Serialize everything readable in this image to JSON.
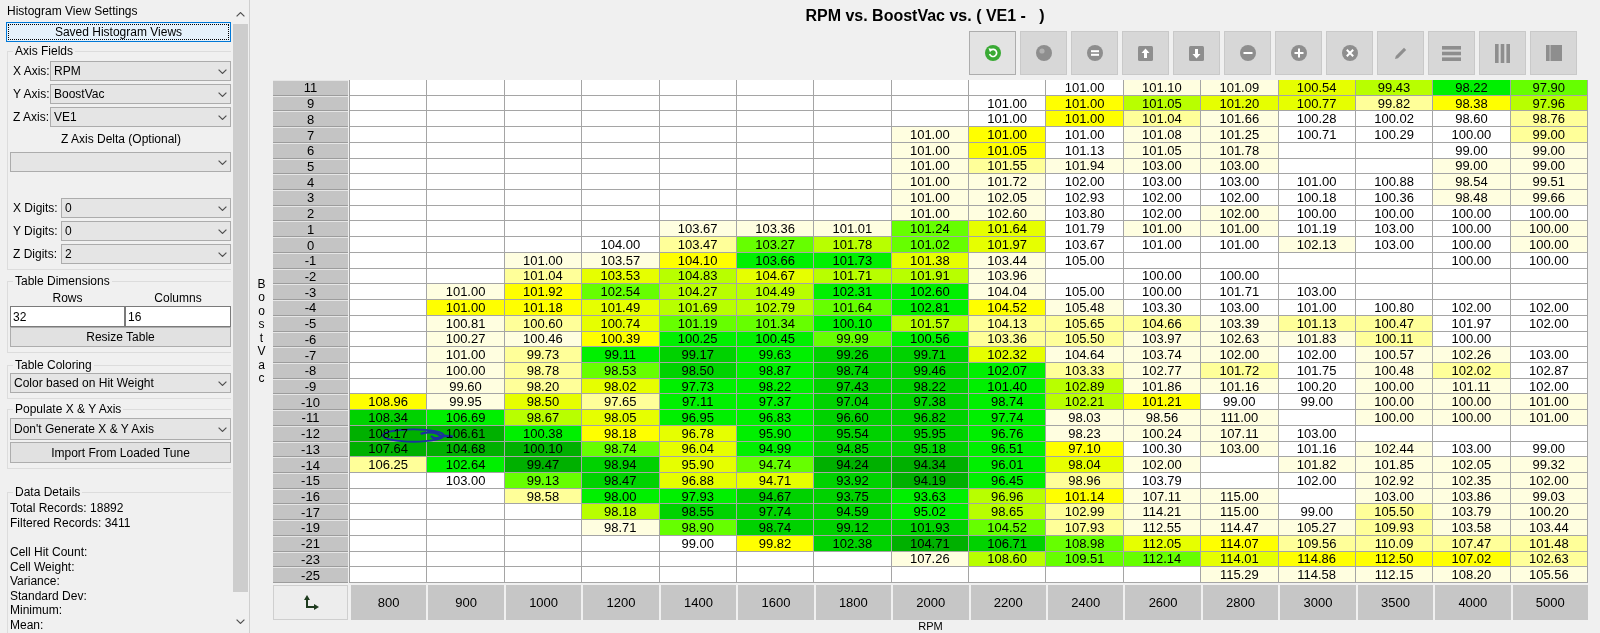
{
  "settings_panel": {
    "title": "Histogram View Settings",
    "saved_views_button": {
      "label": "Saved Histogram Views",
      "focused": true
    },
    "axis_fields": {
      "label": "Axis Fields",
      "axes": [
        {
          "label": "X Axis:",
          "value": "RPM"
        },
        {
          "label": "Y Axis:",
          "value": "BoostVac"
        },
        {
          "label": "Z Axis:",
          "value": "VE1"
        }
      ],
      "delta_label": "Z Axis Delta (Optional)",
      "digits": [
        {
          "label": "X Digits:",
          "value": "0"
        },
        {
          "label": "Y Digits:",
          "value": "0"
        },
        {
          "label": "Z Digits:",
          "value": "2"
        }
      ]
    },
    "table_dimensions": {
      "label": "Table Dimensions",
      "fields": [
        {
          "label": "Rows",
          "value": "32"
        },
        {
          "label": "Columns",
          "value": "16"
        }
      ],
      "button": "Resize Table"
    },
    "table_coloring": {
      "label": "Table Coloring",
      "value": "Color based on Hit Weight"
    },
    "populate_axis": {
      "label": "Populate X & Y Axis",
      "value": "Don't Generate X & Y Axis",
      "button": "Import From Loaded Tune"
    },
    "data_details": {
      "label": "Data Details",
      "totals": [
        "Total Records: 18892",
        "Filtered Records: 3411"
      ],
      "cell_stats": [
        "Cell Hit Count:",
        "Cell Weight:",
        "Variance:",
        "Standard Dev:",
        "Minimum:",
        "Mean:"
      ]
    }
  },
  "histogram": {
    "title": "RPM vs. BoostVac vs. ( VE1 -   )",
    "toolbar": [
      {
        "kind": "refresh",
        "disabled": false
      },
      {
        "kind": "circle",
        "disabled": true
      },
      {
        "kind": "equals",
        "disabled": true
      },
      {
        "kind": "arrow_up",
        "disabled": true
      },
      {
        "kind": "arrow_down",
        "disabled": true
      },
      {
        "kind": "minus",
        "disabled": true
      },
      {
        "kind": "plus",
        "disabled": true
      },
      {
        "kind": "x",
        "disabled": true
      },
      {
        "kind": "pencil",
        "disabled": true
      },
      {
        "kind": "rows",
        "disabled": true
      },
      {
        "kind": "columns",
        "disabled": true
      },
      {
        "kind": "split",
        "disabled": true
      }
    ],
    "y_axis_label": "BoostVac",
    "rows": [
      {
        "label": "11",
        "cells": [
          null,
          null,
          null,
          null,
          null,
          null,
          null,
          null,
          null,
          {
            "value": "101.00",
            "color": "#ffffff"
          },
          {
            "value": "101.10",
            "color": "#fffee0"
          },
          {
            "value": "101.09",
            "color": "#fffee0"
          },
          {
            "value": "100.54",
            "color": "#e6ff00"
          },
          {
            "value": "99.43",
            "color": "#b8ff00"
          },
          {
            "value": "98.22",
            "color": "#00f000"
          },
          {
            "value": "97.90",
            "color": "#66ff00"
          }
        ]
      },
      {
        "label": "9",
        "cells": [
          null,
          null,
          null,
          null,
          null,
          null,
          null,
          null,
          {
            "value": "101.00",
            "color": "#ffffff"
          },
          {
            "value": "101.00",
            "color": "#ffff00"
          },
          {
            "value": "101.05",
            "color": "#b8ff00"
          },
          {
            "value": "101.20",
            "color": "#e6ff00"
          },
          {
            "value": "100.77",
            "color": "#e6ff00"
          },
          {
            "value": "99.82",
            "color": "#ffff99"
          },
          {
            "value": "98.38",
            "color": "#ffff00"
          },
          {
            "value": "97.96",
            "color": "#b8ff00"
          }
        ]
      },
      {
        "label": "8",
        "cells": [
          null,
          null,
          null,
          null,
          null,
          null,
          null,
          null,
          {
            "value": "101.00",
            "color": "#ffffff"
          },
          {
            "value": "101.00",
            "color": "#ffff00"
          },
          {
            "value": "101.04",
            "color": "#ffff99"
          },
          {
            "value": "101.66",
            "color": "#fffee0"
          },
          {
            "value": "100.28",
            "color": "#ffffff"
          },
          {
            "value": "100.02",
            "color": "#ffffff"
          },
          {
            "value": "98.60",
            "color": "#ffffff"
          },
          {
            "value": "98.76",
            "color": "#ffff99"
          }
        ]
      },
      {
        "label": "7",
        "cells": [
          null,
          null,
          null,
          null,
          null,
          null,
          null,
          {
            "value": "101.00",
            "color": "#fffee0"
          },
          {
            "value": "101.00",
            "color": "#ffff00"
          },
          {
            "value": "101.00",
            "color": "#ffffff"
          },
          {
            "value": "101.08",
            "color": "#fffee0"
          },
          {
            "value": "101.25",
            "color": "#fffee0"
          },
          {
            "value": "100.71",
            "color": "#ffffff"
          },
          {
            "value": "100.29",
            "color": "#ffffff"
          },
          {
            "value": "100.00",
            "color": "#ffffff"
          },
          {
            "value": "99.00",
            "color": "#ffff99"
          }
        ]
      },
      {
        "label": "6",
        "cells": [
          null,
          null,
          null,
          null,
          null,
          null,
          null,
          {
            "value": "101.00",
            "color": "#fffee0"
          },
          {
            "value": "101.05",
            "color": "#ffff00"
          },
          {
            "value": "101.13",
            "color": "#ffffff"
          },
          {
            "value": "101.05",
            "color": "#fffee0"
          },
          {
            "value": "101.78",
            "color": "#fffee0"
          },
          null,
          null,
          {
            "value": "99.00",
            "color": "#ffffff"
          },
          {
            "value": "99.00",
            "color": "#fffee0"
          }
        ]
      },
      {
        "label": "5",
        "cells": [
          null,
          null,
          null,
          null,
          null,
          null,
          null,
          {
            "value": "101.00",
            "color": "#fffee0"
          },
          {
            "value": "101.55",
            "color": "#ffff99"
          },
          {
            "value": "101.94",
            "color": "#fffee0"
          },
          {
            "value": "103.00",
            "color": "#fffee0"
          },
          {
            "value": "103.00",
            "color": "#fffee0"
          },
          null,
          null,
          {
            "value": "99.00",
            "color": "#fffee0"
          },
          {
            "value": "99.00",
            "color": "#fffee0"
          }
        ]
      },
      {
        "label": "4",
        "cells": [
          null,
          null,
          null,
          null,
          null,
          null,
          null,
          {
            "value": "101.00",
            "color": "#fffee0"
          },
          {
            "value": "101.72",
            "color": "#fffee0"
          },
          {
            "value": "102.00",
            "color": "#ffffff"
          },
          {
            "value": "103.00",
            "color": "#ffffff"
          },
          {
            "value": "103.00",
            "color": "#ffffff"
          },
          {
            "value": "101.00",
            "color": "#ffffff"
          },
          {
            "value": "100.88",
            "color": "#ffffff"
          },
          {
            "value": "98.54",
            "color": "#fffee0"
          },
          {
            "value": "99.51",
            "color": "#fffee0"
          }
        ]
      },
      {
        "label": "3",
        "cells": [
          null,
          null,
          null,
          null,
          null,
          null,
          null,
          {
            "value": "101.00",
            "color": "#fffee0"
          },
          {
            "value": "102.05",
            "color": "#fffee0"
          },
          {
            "value": "102.93",
            "color": "#ffffff"
          },
          {
            "value": "102.00",
            "color": "#ffffff"
          },
          {
            "value": "102.00",
            "color": "#ffffff"
          },
          {
            "value": "100.18",
            "color": "#ffffff"
          },
          {
            "value": "100.36",
            "color": "#ffffff"
          },
          {
            "value": "98.48",
            "color": "#fffee0"
          },
          {
            "value": "99.66",
            "color": "#fffee0"
          }
        ]
      },
      {
        "label": "2",
        "cells": [
          null,
          null,
          null,
          null,
          null,
          null,
          null,
          {
            "value": "101.00",
            "color": "#fffee0"
          },
          {
            "value": "102.60",
            "color": "#fffee0"
          },
          {
            "value": "103.80",
            "color": "#ffffff"
          },
          {
            "value": "102.00",
            "color": "#ffffff"
          },
          {
            "value": "102.00",
            "color": "#fffee0"
          },
          {
            "value": "100.00",
            "color": "#ffffff"
          },
          {
            "value": "100.00",
            "color": "#ffffff"
          },
          {
            "value": "100.00",
            "color": "#ffffff"
          },
          {
            "value": "100.00",
            "color": "#ffffff"
          }
        ]
      },
      {
        "label": "1",
        "cells": [
          null,
          null,
          null,
          null,
          {
            "value": "103.67",
            "color": "#fffee0"
          },
          {
            "value": "103.36",
            "color": "#fffee0"
          },
          {
            "value": "101.01",
            "color": "#fffee0"
          },
          {
            "value": "101.24",
            "color": "#66ff00"
          },
          {
            "value": "101.64",
            "color": "#e6ff00"
          },
          {
            "value": "101.79",
            "color": "#ffffff"
          },
          {
            "value": "101.00",
            "color": "#fffee0"
          },
          {
            "value": "101.00",
            "color": "#fffee0"
          },
          {
            "value": "101.19",
            "color": "#ffffff"
          },
          {
            "value": "103.00",
            "color": "#ffffff"
          },
          {
            "value": "100.00",
            "color": "#ffffff"
          },
          {
            "value": "100.00",
            "color": "#fffee0"
          }
        ]
      },
      {
        "label": "0",
        "cells": [
          null,
          null,
          null,
          {
            "value": "104.00",
            "color": "#ffffff"
          },
          {
            "value": "103.47",
            "color": "#ffff99"
          },
          {
            "value": "103.27",
            "color": "#66ff00"
          },
          {
            "value": "101.78",
            "color": "#b8ff00"
          },
          {
            "value": "101.02",
            "color": "#66ff00"
          },
          {
            "value": "101.97",
            "color": "#e6ff00"
          },
          {
            "value": "103.67",
            "color": "#ffffff"
          },
          {
            "value": "101.00",
            "color": "#ffffff"
          },
          {
            "value": "101.00",
            "color": "#ffffff"
          },
          {
            "value": "102.13",
            "color": "#fffee0"
          },
          {
            "value": "103.00",
            "color": "#ffffff"
          },
          {
            "value": "100.00",
            "color": "#ffffff"
          },
          {
            "value": "100.00",
            "color": "#fffee0"
          }
        ]
      },
      {
        "label": "-1",
        "cells": [
          null,
          null,
          {
            "value": "101.00",
            "color": "#fffee0"
          },
          {
            "value": "103.57",
            "color": "#fffee0"
          },
          {
            "value": "104.10",
            "color": "#ffff00"
          },
          {
            "value": "103.66",
            "color": "#00f000"
          },
          {
            "value": "101.73",
            "color": "#00f000"
          },
          {
            "value": "101.38",
            "color": "#e6ff00"
          },
          {
            "value": "103.44",
            "color": "#fffee0"
          },
          {
            "value": "105.00",
            "color": "#ffffff"
          },
          null,
          null,
          null,
          null,
          {
            "value": "100.00",
            "color": "#ffffff"
          },
          {
            "value": "100.00",
            "color": "#ffffff"
          }
        ]
      },
      {
        "label": "-2",
        "cells": [
          null,
          null,
          {
            "value": "101.04",
            "color": "#ffff99"
          },
          {
            "value": "103.53",
            "color": "#e6ff00"
          },
          {
            "value": "104.83",
            "color": "#b8ff00"
          },
          {
            "value": "104.67",
            "color": "#e6ff00"
          },
          {
            "value": "101.71",
            "color": "#b8ff00"
          },
          {
            "value": "101.91",
            "color": "#b8ff00"
          },
          {
            "value": "103.96",
            "color": "#fffee0"
          },
          null,
          {
            "value": "100.00",
            "color": "#ffffff"
          },
          {
            "value": "100.00",
            "color": "#ffffff"
          },
          null,
          null,
          null,
          null
        ]
      },
      {
        "label": "-3",
        "cells": [
          null,
          {
            "value": "101.00",
            "color": "#fffee0"
          },
          {
            "value": "101.92",
            "color": "#ffff00"
          },
          {
            "value": "102.54",
            "color": "#66ff00"
          },
          {
            "value": "104.27",
            "color": "#b8ff00"
          },
          {
            "value": "104.49",
            "color": "#b8ff00"
          },
          {
            "value": "102.31",
            "color": "#00f000"
          },
          {
            "value": "102.60",
            "color": "#00f000"
          },
          {
            "value": "104.04",
            "color": "#fffee0"
          },
          {
            "value": "105.00",
            "color": "#ffffff"
          },
          {
            "value": "100.00",
            "color": "#ffffff"
          },
          {
            "value": "101.71",
            "color": "#ffffff"
          },
          {
            "value": "103.00",
            "color": "#ffffff"
          },
          null,
          null,
          null
        ]
      },
      {
        "label": "-4",
        "cells": [
          null,
          {
            "value": "101.00",
            "color": "#ffff00"
          },
          {
            "value": "101.18",
            "color": "#ffff00"
          },
          {
            "value": "101.49",
            "color": "#e6ff00"
          },
          {
            "value": "101.69",
            "color": "#b8ff00"
          },
          {
            "value": "102.79",
            "color": "#b8ff00"
          },
          {
            "value": "101.64",
            "color": "#66ff00"
          },
          {
            "value": "102.81",
            "color": "#00f000"
          },
          {
            "value": "104.52",
            "color": "#ffff00"
          },
          {
            "value": "105.48",
            "color": "#fffee0"
          },
          {
            "value": "103.30",
            "color": "#ffffff"
          },
          {
            "value": "103.00",
            "color": "#ffffff"
          },
          {
            "value": "101.00",
            "color": "#ffffff"
          },
          {
            "value": "100.80",
            "color": "#ffffff"
          },
          {
            "value": "102.00",
            "color": "#ffffff"
          },
          {
            "value": "102.00",
            "color": "#ffffff"
          }
        ]
      },
      {
        "label": "-5",
        "cells": [
          null,
          {
            "value": "100.81",
            "color": "#fffee0"
          },
          {
            "value": "100.60",
            "color": "#ffff99"
          },
          {
            "value": "100.74",
            "color": "#e6ff00"
          },
          {
            "value": "101.19",
            "color": "#66ff00"
          },
          {
            "value": "101.34",
            "color": "#66ff00"
          },
          {
            "value": "100.10",
            "color": "#00f000"
          },
          {
            "value": "101.57",
            "color": "#b8ff00"
          },
          {
            "value": "104.13",
            "color": "#ffff99"
          },
          {
            "value": "105.65",
            "color": "#ffff99"
          },
          {
            "value": "104.66",
            "color": "#ffff99"
          },
          {
            "value": "103.39",
            "color": "#fffee0"
          },
          {
            "value": "101.13",
            "color": "#ffff99"
          },
          {
            "value": "100.47",
            "color": "#ffff99"
          },
          {
            "value": "101.97",
            "color": "#ffffff"
          },
          {
            "value": "102.00",
            "color": "#ffffff"
          }
        ]
      },
      {
        "label": "-6",
        "cells": [
          null,
          {
            "value": "100.27",
            "color": "#fffee0"
          },
          {
            "value": "100.46",
            "color": "#fffee0"
          },
          {
            "value": "100.39",
            "color": "#ffff00"
          },
          {
            "value": "100.25",
            "color": "#00f000"
          },
          {
            "value": "100.45",
            "color": "#00f000"
          },
          {
            "value": "99.99",
            "color": "#66ff00"
          },
          {
            "value": "100.56",
            "color": "#00f000"
          },
          {
            "value": "103.36",
            "color": "#ffff99"
          },
          {
            "value": "105.50",
            "color": "#ffff99"
          },
          {
            "value": "103.97",
            "color": "#fffee0"
          },
          {
            "value": "102.63",
            "color": "#fffee0"
          },
          {
            "value": "101.83",
            "color": "#fffee0"
          },
          {
            "value": "100.11",
            "color": "#ffff99"
          },
          {
            "value": "100.00",
            "color": "#ffffff"
          },
          null
        ]
      },
      {
        "label": "-7",
        "cells": [
          null,
          {
            "value": "101.00",
            "color": "#fffee0"
          },
          {
            "value": "99.73",
            "color": "#ffff99"
          },
          {
            "value": "99.11",
            "color": "#00f000"
          },
          {
            "value": "99.17",
            "color": "#00d200"
          },
          {
            "value": "99.63",
            "color": "#00f000"
          },
          {
            "value": "99.26",
            "color": "#00d200"
          },
          {
            "value": "99.71",
            "color": "#00d200"
          },
          {
            "value": "102.32",
            "color": "#e6ff00"
          },
          {
            "value": "104.64",
            "color": "#fffee0"
          },
          {
            "value": "103.74",
            "color": "#fffee0"
          },
          {
            "value": "102.00",
            "color": "#fffee0"
          },
          {
            "value": "102.00",
            "color": "#ffffff"
          },
          {
            "value": "100.57",
            "color": "#fffee0"
          },
          {
            "value": "102.26",
            "color": "#fffee0"
          },
          {
            "value": "103.00",
            "color": "#ffffff"
          }
        ]
      },
      {
        "label": "-8",
        "cells": [
          null,
          {
            "value": "100.00",
            "color": "#fffee0"
          },
          {
            "value": "98.78",
            "color": "#ffff99"
          },
          {
            "value": "98.53",
            "color": "#66ff00"
          },
          {
            "value": "98.50",
            "color": "#00d200"
          },
          {
            "value": "98.87",
            "color": "#00f000"
          },
          {
            "value": "98.74",
            "color": "#00d200"
          },
          {
            "value": "99.46",
            "color": "#00d200"
          },
          {
            "value": "102.07",
            "color": "#00f000"
          },
          {
            "value": "103.33",
            "color": "#ffff99"
          },
          {
            "value": "102.77",
            "color": "#fffee0"
          },
          {
            "value": "101.72",
            "color": "#ffff99"
          },
          {
            "value": "101.75",
            "color": "#ffffff"
          },
          {
            "value": "100.48",
            "color": "#fffee0"
          },
          {
            "value": "102.02",
            "color": "#ffff99"
          },
          {
            "value": "102.87",
            "color": "#ffffff"
          }
        ]
      },
      {
        "label": "-9",
        "cells": [
          null,
          {
            "value": "99.60",
            "color": "#fffee0"
          },
          {
            "value": "98.20",
            "color": "#ffff99"
          },
          {
            "value": "98.02",
            "color": "#e6ff00"
          },
          {
            "value": "97.73",
            "color": "#00f000"
          },
          {
            "value": "98.22",
            "color": "#00f000"
          },
          {
            "value": "97.43",
            "color": "#00d200"
          },
          {
            "value": "98.22",
            "color": "#00d200"
          },
          {
            "value": "101.40",
            "color": "#00f000"
          },
          {
            "value": "102.89",
            "color": "#b8ff00"
          },
          {
            "value": "101.86",
            "color": "#fffee0"
          },
          {
            "value": "101.16",
            "color": "#fffee0"
          },
          {
            "value": "100.20",
            "color": "#ffffff"
          },
          {
            "value": "100.00",
            "color": "#fffee0"
          },
          {
            "value": "101.11",
            "color": "#fffee0"
          },
          {
            "value": "102.00",
            "color": "#ffffff"
          }
        ]
      },
      {
        "label": "-10",
        "cells": [
          {
            "value": "108.96",
            "color": "#ffff00"
          },
          {
            "value": "99.95",
            "color": "#fffee0"
          },
          {
            "value": "98.50",
            "color": "#e6ff00"
          },
          {
            "value": "97.65",
            "color": "#ffff99"
          },
          {
            "value": "97.11",
            "color": "#00f000"
          },
          {
            "value": "97.37",
            "color": "#00f000"
          },
          {
            "value": "97.04",
            "color": "#00d200"
          },
          {
            "value": "97.38",
            "color": "#00d200"
          },
          {
            "value": "98.74",
            "color": "#00f000"
          },
          {
            "value": "102.21",
            "color": "#b8ff00"
          },
          {
            "value": "101.21",
            "color": "#ffff00"
          },
          {
            "value": "99.00",
            "color": "#ffffff"
          },
          {
            "value": "99.00",
            "color": "#ffffff"
          },
          {
            "value": "100.00",
            "color": "#fffee0"
          },
          {
            "value": "100.00",
            "color": "#fffee0"
          },
          {
            "value": "101.00",
            "color": "#fffee0"
          }
        ]
      },
      {
        "label": "-11",
        "cells": [
          {
            "value": "108.34",
            "color": "#00d200"
          },
          {
            "value": "106.69",
            "color": "#00f000"
          },
          {
            "value": "98.67",
            "color": "#b8ff00"
          },
          {
            "value": "98.05",
            "color": "#e6ff00"
          },
          {
            "value": "96.95",
            "color": "#00f000"
          },
          {
            "value": "96.83",
            "color": "#00f000"
          },
          {
            "value": "96.60",
            "color": "#00d200"
          },
          {
            "value": "96.82",
            "color": "#00d200"
          },
          {
            "value": "97.74",
            "color": "#00f000"
          },
          {
            "value": "98.03",
            "color": "#fffee0"
          },
          {
            "value": "98.56",
            "color": "#fffee0"
          },
          {
            "value": "111.00",
            "color": "#fffee0"
          },
          null,
          {
            "value": "100.00",
            "color": "#fffee0"
          },
          {
            "value": "100.00",
            "color": "#fffee0"
          },
          {
            "value": "101.00",
            "color": "#fffee0"
          }
        ]
      },
      {
        "label": "-12",
        "cells": [
          {
            "value": "108.17",
            "color": "#00b000"
          },
          {
            "value": "106.61",
            "color": "#00b000"
          },
          {
            "value": "100.38",
            "color": "#00f000"
          },
          {
            "value": "98.18",
            "color": "#ffff00"
          },
          {
            "value": "96.78",
            "color": "#e6ff00"
          },
          {
            "value": "95.90",
            "color": "#00f000"
          },
          {
            "value": "95.54",
            "color": "#00d200"
          },
          {
            "value": "95.95",
            "color": "#00d200"
          },
          {
            "value": "96.76",
            "color": "#00f000"
          },
          {
            "value": "98.23",
            "color": "#fffee0"
          },
          {
            "value": "100.24",
            "color": "#fffee0"
          },
          {
            "value": "107.11",
            "color": "#fffee0"
          },
          {
            "value": "103.00",
            "color": "#ffffff"
          },
          null,
          null,
          null
        ]
      },
      {
        "label": "-13",
        "cells": [
          {
            "value": "107.64",
            "color": "#00b000"
          },
          {
            "value": "104.68",
            "color": "#00b000"
          },
          {
            "value": "100.10",
            "color": "#00b000"
          },
          {
            "value": "98.74",
            "color": "#66ff00"
          },
          {
            "value": "96.04",
            "color": "#e6ff00"
          },
          {
            "value": "94.99",
            "color": "#00f000"
          },
          {
            "value": "94.85",
            "color": "#00d200"
          },
          {
            "value": "95.18",
            "color": "#00d200"
          },
          {
            "value": "96.51",
            "color": "#00f000"
          },
          {
            "value": "97.10",
            "color": "#ffff00"
          },
          {
            "value": "100.30",
            "color": "#ffffff"
          },
          {
            "value": "103.00",
            "color": "#fffee0"
          },
          {
            "value": "101.16",
            "color": "#ffffff"
          },
          {
            "value": "102.44",
            "color": "#fffee0"
          },
          {
            "value": "103.00",
            "color": "#ffffff"
          },
          {
            "value": "99.00",
            "color": "#ffffff"
          }
        ]
      },
      {
        "label": "-14",
        "cells": [
          {
            "value": "106.25",
            "color": "#ffff99"
          },
          {
            "value": "102.64",
            "color": "#00f000"
          },
          {
            "value": "99.47",
            "color": "#00b000"
          },
          {
            "value": "98.94",
            "color": "#00d200"
          },
          {
            "value": "95.90",
            "color": "#e6ff00"
          },
          {
            "value": "94.74",
            "color": "#66ff00"
          },
          {
            "value": "94.24",
            "color": "#00b000"
          },
          {
            "value": "94.34",
            "color": "#00b000"
          },
          {
            "value": "96.01",
            "color": "#00f000"
          },
          {
            "value": "98.04",
            "color": "#e6ff00"
          },
          {
            "value": "102.00",
            "color": "#fffee0"
          },
          null,
          {
            "value": "101.82",
            "color": "#fffee0"
          },
          {
            "value": "101.85",
            "color": "#fffee0"
          },
          {
            "value": "102.05",
            "color": "#fffee0"
          },
          {
            "value": "99.32",
            "color": "#fffee0"
          }
        ]
      },
      {
        "label": "-15",
        "cells": [
          null,
          {
            "value": "103.00",
            "color": "#ffffff"
          },
          {
            "value": "99.13",
            "color": "#66ff00"
          },
          {
            "value": "98.47",
            "color": "#00d200"
          },
          {
            "value": "96.88",
            "color": "#e6ff00"
          },
          {
            "value": "94.71",
            "color": "#e6ff00"
          },
          {
            "value": "93.92",
            "color": "#00d200"
          },
          {
            "value": "94.19",
            "color": "#00b000"
          },
          {
            "value": "96.45",
            "color": "#00f000"
          },
          {
            "value": "98.96",
            "color": "#ffff99"
          },
          {
            "value": "103.79",
            "color": "#ffffff"
          },
          null,
          {
            "value": "102.00",
            "color": "#ffffff"
          },
          {
            "value": "102.92",
            "color": "#fffee0"
          },
          {
            "value": "102.35",
            "color": "#fffee0"
          },
          {
            "value": "102.00",
            "color": "#fffee0"
          }
        ]
      },
      {
        "label": "-16",
        "cells": [
          null,
          null,
          {
            "value": "98.58",
            "color": "#ffff99"
          },
          {
            "value": "98.00",
            "color": "#00f000"
          },
          {
            "value": "97.93",
            "color": "#00f000"
          },
          {
            "value": "94.67",
            "color": "#00d200"
          },
          {
            "value": "93.75",
            "color": "#00d200"
          },
          {
            "value": "93.63",
            "color": "#00f000"
          },
          {
            "value": "96.96",
            "color": "#b8ff00"
          },
          {
            "value": "101.14",
            "color": "#ffff00"
          },
          {
            "value": "107.11",
            "color": "#fffee0"
          },
          {
            "value": "115.00",
            "color": "#fffee0"
          },
          null,
          {
            "value": "103.00",
            "color": "#fffee0"
          },
          {
            "value": "103.86",
            "color": "#fffee0"
          },
          {
            "value": "99.03",
            "color": "#fffee0"
          }
        ]
      },
      {
        "label": "-17",
        "cells": [
          null,
          null,
          null,
          {
            "value": "98.18",
            "color": "#b8ff00"
          },
          {
            "value": "98.55",
            "color": "#00d200"
          },
          {
            "value": "97.74",
            "color": "#00d200"
          },
          {
            "value": "94.59",
            "color": "#00d200"
          },
          {
            "value": "95.02",
            "color": "#00f000"
          },
          {
            "value": "98.65",
            "color": "#b8ff00"
          },
          {
            "value": "102.99",
            "color": "#ffff99"
          },
          {
            "value": "114.21",
            "color": "#fffee0"
          },
          {
            "value": "115.00",
            "color": "#fffee0"
          },
          {
            "value": "99.00",
            "color": "#ffffff"
          },
          {
            "value": "105.50",
            "color": "#ffff99"
          },
          {
            "value": "103.79",
            "color": "#fffee0"
          },
          {
            "value": "100.20",
            "color": "#fffee0"
          }
        ]
      },
      {
        "label": "-19",
        "cells": [
          null,
          null,
          null,
          {
            "value": "98.71",
            "color": "#fffee0"
          },
          {
            "value": "98.90",
            "color": "#66ff00"
          },
          {
            "value": "98.74",
            "color": "#00d200"
          },
          {
            "value": "99.12",
            "color": "#00d200"
          },
          {
            "value": "101.93",
            "color": "#00d200"
          },
          {
            "value": "104.52",
            "color": "#66ff00"
          },
          {
            "value": "107.93",
            "color": "#ffff99"
          },
          {
            "value": "112.55",
            "color": "#fffee0"
          },
          {
            "value": "114.47",
            "color": "#fffee0"
          },
          {
            "value": "105.27",
            "color": "#fffee0"
          },
          {
            "value": "109.93",
            "color": "#ffff99"
          },
          {
            "value": "103.58",
            "color": "#fffee0"
          },
          {
            "value": "103.44",
            "color": "#fffee0"
          }
        ]
      },
      {
        "label": "-21",
        "cells": [
          null,
          null,
          null,
          null,
          {
            "value": "99.00",
            "color": "#ffffff"
          },
          {
            "value": "99.82",
            "color": "#ffff00"
          },
          {
            "value": "102.38",
            "color": "#00d200"
          },
          {
            "value": "104.71",
            "color": "#00b000"
          },
          {
            "value": "106.71",
            "color": "#00d200"
          },
          {
            "value": "108.98",
            "color": "#66ff00"
          },
          {
            "value": "112.05",
            "color": "#e6ff00"
          },
          {
            "value": "114.07",
            "color": "#ffff00"
          },
          {
            "value": "109.56",
            "color": "#ffff99"
          },
          {
            "value": "110.09",
            "color": "#ffff99"
          },
          {
            "value": "107.47",
            "color": "#ffff99"
          },
          {
            "value": "101.48",
            "color": "#ffff99"
          }
        ]
      },
      {
        "label": "-23",
        "cells": [
          null,
          null,
          null,
          null,
          null,
          null,
          null,
          {
            "value": "107.26",
            "color": "#fffee0"
          },
          {
            "value": "108.60",
            "color": "#b8ff00"
          },
          {
            "value": "109.51",
            "color": "#66ff00"
          },
          {
            "value": "112.14",
            "color": "#66ff00"
          },
          {
            "value": "114.01",
            "color": "#e6ff00"
          },
          {
            "value": "114.86",
            "color": "#ffff00"
          },
          {
            "value": "112.50",
            "color": "#ffff00"
          },
          {
            "value": "107.02",
            "color": "#ffff00"
          },
          {
            "value": "102.63",
            "color": "#ffff99"
          }
        ]
      },
      {
        "label": "-25",
        "cells": [
          null,
          null,
          null,
          null,
          null,
          null,
          null,
          null,
          null,
          null,
          null,
          {
            "value": "115.29",
            "color": "#fffee0"
          },
          {
            "value": "114.58",
            "color": "#fffee0"
          },
          {
            "value": "112.15",
            "color": "#fffee0"
          },
          {
            "value": "108.20",
            "color": "#fffee0"
          },
          {
            "value": "105.56",
            "color": "#fffee0"
          }
        ]
      }
    ],
    "x_axis_values": [
      "800",
      "900",
      "1000",
      "1200",
      "1400",
      "1600",
      "1800",
      "2000",
      "2200",
      "2400",
      "2600",
      "2800",
      "3000",
      "3500",
      "4000",
      "5000"
    ],
    "x_axis_label": "RPM"
  }
}
